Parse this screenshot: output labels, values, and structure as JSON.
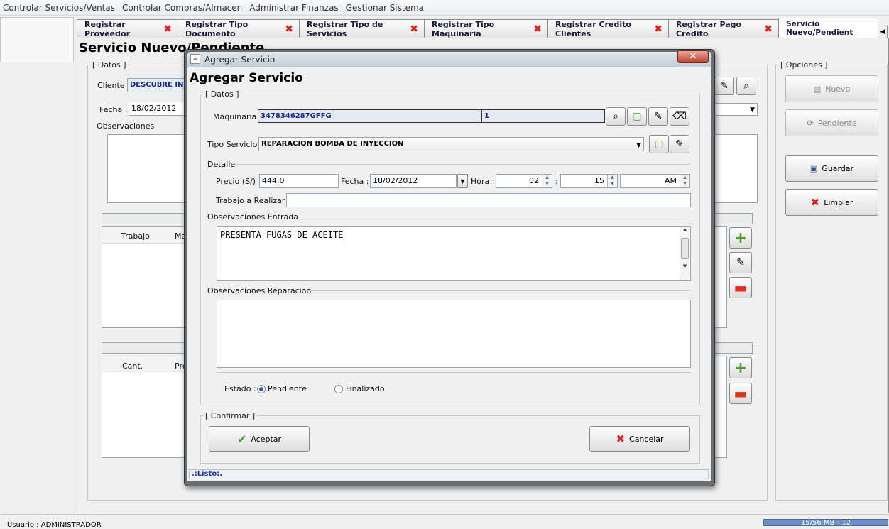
{
  "menu": [
    "Controlar Servicios/Ventas",
    "Controlar Compras/Almacen",
    "Administrar Finanzas",
    "Gestionar Sistema"
  ],
  "tabs": [
    {
      "label": "Registrar Proveedor",
      "close": "✖"
    },
    {
      "label": "Registrar Tipo Documento",
      "close": "✖"
    },
    {
      "label": "Registrar Tipo de Servicios",
      "close": "✖"
    },
    {
      "label": "Registrar Tipo Maquinaria",
      "close": "✖"
    },
    {
      "label": "Registrar Credito Clientes",
      "close": "✖"
    },
    {
      "label": "Registrar Pago Credito",
      "close": "✖"
    },
    {
      "label": "Servicio Nuevo/Pendient"
    }
  ],
  "background": {
    "title": "Servicio Nuevo/Pendiente",
    "datos_legend": "[ Datos ]",
    "cliente_label": "Cliente :",
    "cliente_value": "DESCUBRE INNO",
    "fecha_label": "Fecha :",
    "fecha_value": "18/02/2012",
    "observaciones_label": "Observaciones",
    "table1_col1": "Trabajo",
    "table1_col2": "Ma",
    "table2_col1": "Cant.",
    "table2_col2": "Pre",
    "opciones_legend": "[ Opciones ]",
    "nuevo_label": "Nuevo",
    "pendiente_label": "Pendiente",
    "guardar_label": "Guardar",
    "limpiar_label": "Limpiar"
  },
  "status": {
    "user": "Usuario : ADMINISTRADOR",
    "memory": "15/56 MB - 12"
  },
  "dialog": {
    "window_title": "Agregar Servicio",
    "heading": "Agregar Servicio",
    "datos_legend": "[ Datos ]",
    "maquinaria_label": "Maquinaria :",
    "maquinaria_code": "3478346287GFFG",
    "maquinaria_id": "1",
    "tipo_servicio_label": "Tipo Servicio :",
    "tipo_servicio_value": "REPARACION BOMBA DE INYECCION",
    "detalle_label": "Detalle",
    "precio_label": "Precio (S/) :",
    "precio_value": "444.0",
    "fecha_label": "Fecha :",
    "fecha_value": "18/02/2012",
    "hora_label": "Hora :",
    "hora_h": "02",
    "hora_sep": ":",
    "hora_m": "15",
    "hora_ampm": "AM",
    "trabajo_label": "Trabajo a Realizar :",
    "trabajo_value": "",
    "obs_entrada_label": "Observaciones Entrada",
    "obs_entrada_value": "PRESENTA FUGAS DE ACEITE",
    "obs_reparacion_label": "Observaciones Reparacion",
    "obs_reparacion_value": "",
    "estado_label": "Estado :",
    "estado_pendiente": "Pendiente",
    "estado_finalizado": "Finalizado",
    "confirmar_legend": "[ Confirmar ]",
    "aceptar_label": "Aceptar",
    "cancelar_label": "Cancelar",
    "status_text": ".:Listo:."
  },
  "colors": {
    "accent_blue": "#2e5d9e",
    "close_red": "#e02020",
    "dialog_frame": "#6b6f72"
  }
}
